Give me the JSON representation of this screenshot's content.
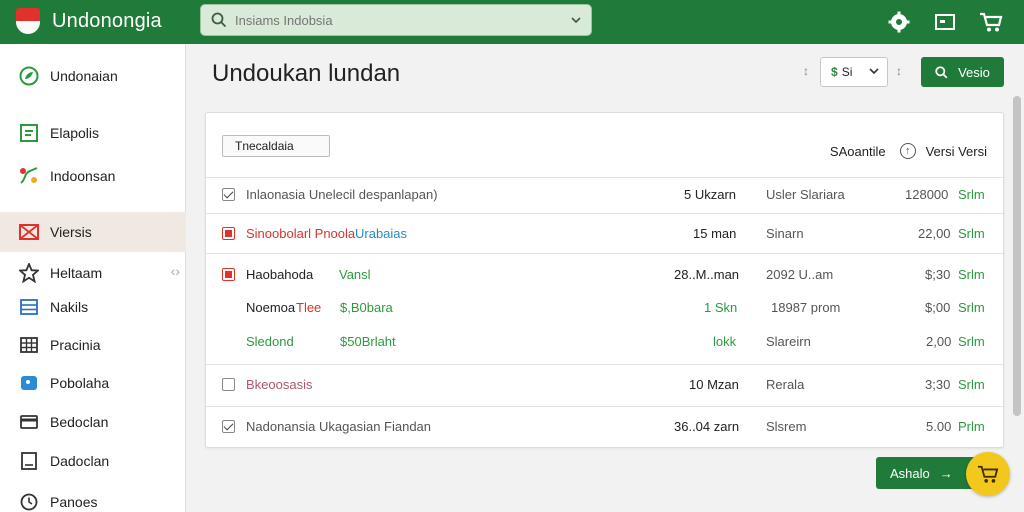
{
  "header": {
    "brand": "Undonongia",
    "search_placeholder": "Insiams Indobsia"
  },
  "sidebar": {
    "items": [
      {
        "label": "Undonaian",
        "icon": "leaf-icon"
      },
      {
        "label": "Elapolis",
        "icon": "chart-icon"
      },
      {
        "label": "Indoonsan",
        "icon": "route-icon"
      },
      {
        "label": "Viersis",
        "icon": "envelope-icon"
      },
      {
        "label": "Heltaam",
        "icon": "star-icon"
      },
      {
        "label": "Nakils",
        "icon": "list-icon"
      },
      {
        "label": "Pracinia",
        "icon": "grid-icon"
      },
      {
        "label": "Pobolaha",
        "icon": "chat-icon"
      },
      {
        "label": "Bedoclan",
        "icon": "card-icon"
      },
      {
        "label": "Dadoclan",
        "icon": "document-icon"
      },
      {
        "label": "Panoes",
        "icon": "clock-icon"
      }
    ]
  },
  "main": {
    "title": "Undoukan lundan",
    "select_label": "Si",
    "select_symbol": "$",
    "view_button": "Vesio",
    "filter_chip": "Tnecaldaia",
    "head_left": "SAoantile",
    "head_right": "Versi Versi",
    "action_button": "Ashalo"
  },
  "table": {
    "rows": [
      {
        "name": "Inlaonasia Unelecil despanlapan)",
        "qty": "5 Ukzarn",
        "type": "Usler Slariara",
        "price": "128000",
        "unit": "Srlm",
        "check": "checked"
      },
      {
        "name_a": "Sinoobolarl Pnoola",
        "name_b": "Urabaias",
        "qty": "15 man",
        "type": "Sinarn",
        "price": "22,00",
        "unit": "Srlm",
        "check": "red"
      },
      {
        "name": "Haobahoda",
        "name_tag": "Vansl",
        "qty": "28..M..man",
        "type": "2092 U..am",
        "price": "$;30",
        "unit": "Srlm",
        "check": "red"
      },
      {
        "name_a": "Noemoa",
        "name_b": "Tlee",
        "name_tag": "$,B0bara",
        "qty": "1 Skn",
        "type": "18987 prom",
        "price": "$;00",
        "unit": "Srlm",
        "check": "none"
      },
      {
        "name": "Sledond",
        "name_tag": "$50Brlaht",
        "qty": "lokk",
        "type": "Slareirn",
        "price": "2,00",
        "unit": "Srlm",
        "check": "none"
      },
      {
        "name": "Bkeoosasis",
        "qty": "10 Mzan",
        "type": "Rerala",
        "price": "3;30",
        "unit": "Srlm",
        "check": "empty"
      },
      {
        "name": "Nadonansia Ukagasian Fiandan",
        "qty": "36..04 zarn",
        "type": "Slsrem",
        "price": "5.00",
        "unit": "Prlm",
        "check": "checked"
      }
    ]
  },
  "colors": {
    "brand_green": "#207a3a",
    "accent_green": "#2c9a3e",
    "alert_red": "#e0322b",
    "fab_yellow": "#f2c81d"
  }
}
